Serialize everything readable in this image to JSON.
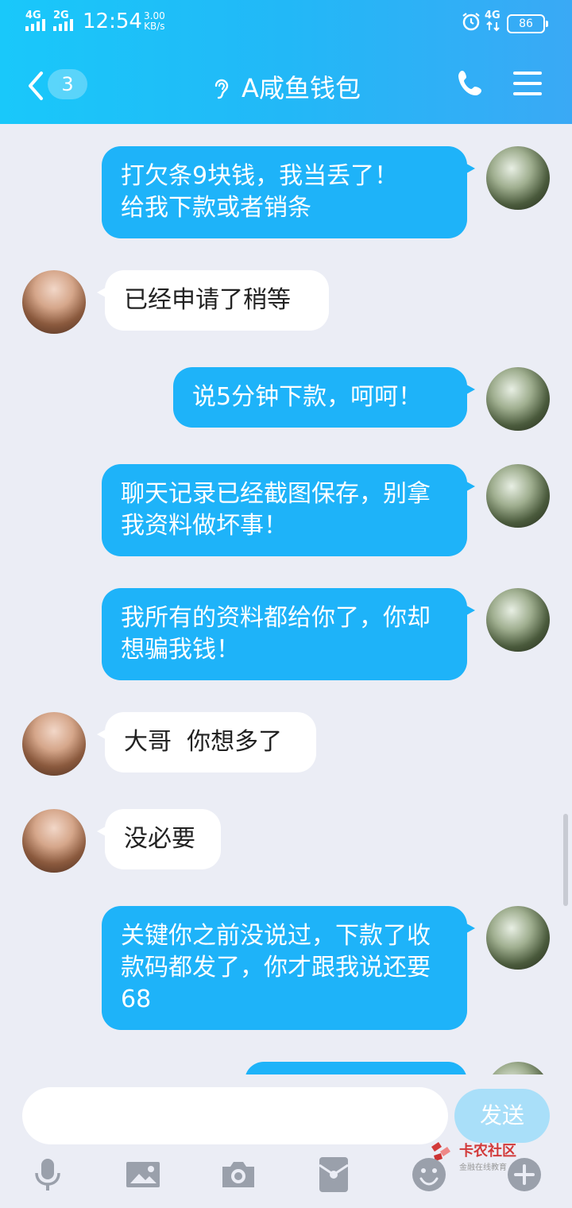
{
  "status_bar": {
    "network1": "4G",
    "network2": "2G",
    "time": "12:54",
    "speed_value": "3.00",
    "speed_unit": "KB/s",
    "network_right": "4G",
    "battery": "86"
  },
  "header": {
    "unread_count": "3",
    "title": "A咸鱼钱包"
  },
  "messages": [
    {
      "side": "out",
      "text": "打欠条9块钱，我当丢了！\n给我下款或者销条"
    },
    {
      "side": "in",
      "text": "已经申请了稍等"
    },
    {
      "side": "out",
      "text": "说5分钟下款，呵呵！"
    },
    {
      "side": "out",
      "text": "聊天记录已经截图保存，别拿我资料做坏事！"
    },
    {
      "side": "out",
      "text": "我所有的资料都给你了，你却想骗我钱！"
    },
    {
      "side": "in",
      "text": "大哥  你想多了"
    },
    {
      "side": "in",
      "text": "没必要"
    },
    {
      "side": "out",
      "text": "关键你之前没说过，下款了收款码都发了，你才跟我说还要68"
    }
  ],
  "input": {
    "value": "",
    "send_label": "发送"
  },
  "watermark": {
    "name": "卡农社区",
    "tagline": "金融在线教育"
  },
  "colors": {
    "header": "#22b8f7",
    "outgoing_bubble": "#1eb3f9",
    "incoming_bubble": "#ffffff",
    "background": "#ebedf5",
    "send_button": "#a9dff9"
  },
  "icons": [
    "back-chevron-icon",
    "ear-icon",
    "phone-icon",
    "menu-icon",
    "microphone-icon",
    "image-icon",
    "camera-icon",
    "red-packet-icon",
    "emoji-icon",
    "plus-icon"
  ]
}
